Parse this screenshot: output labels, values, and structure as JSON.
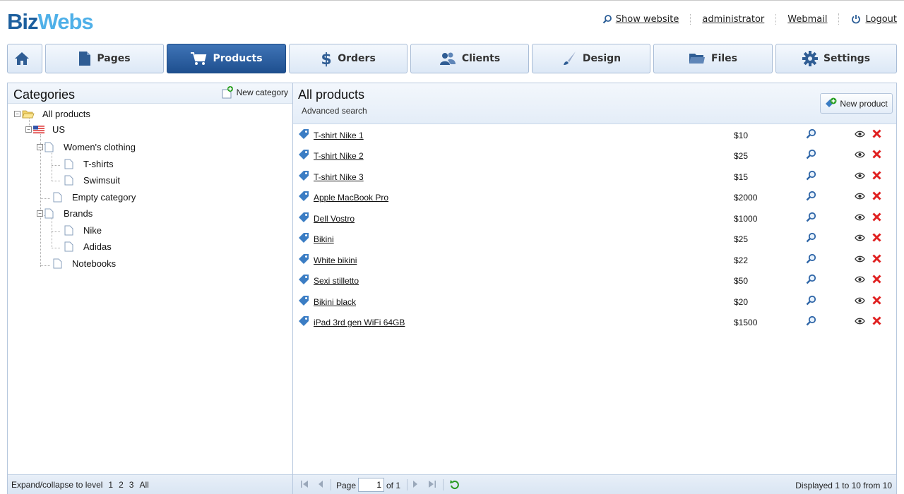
{
  "header": {
    "logo_part1": "Biz",
    "logo_part2": "Webs",
    "links": [
      "Show website",
      "administrator",
      "Webmail",
      "Logout"
    ]
  },
  "nav": {
    "tabs": [
      {
        "label": "",
        "icon": "home-icon"
      },
      {
        "label": "Pages",
        "icon": "page-icon"
      },
      {
        "label": "Products",
        "icon": "cart-icon",
        "active": true
      },
      {
        "label": "Orders",
        "icon": "dollar-icon"
      },
      {
        "label": "Clients",
        "icon": "users-icon"
      },
      {
        "label": "Design",
        "icon": "brush-icon"
      },
      {
        "label": "Files",
        "icon": "folder-icon"
      },
      {
        "label": "Settings",
        "icon": "gear-icon"
      }
    ]
  },
  "categories": {
    "title": "Categories",
    "new_category": "New category",
    "tree": [
      "All products",
      "US",
      "Women's clothing",
      "T-shirts",
      "Swimsuit",
      "Empty category",
      "Brands",
      "Nike",
      "Adidas",
      "Notebooks"
    ],
    "footer_label": "Expand/collapse to level",
    "levels": [
      "1",
      "2",
      "3",
      "All"
    ]
  },
  "products": {
    "title": "All products",
    "advanced_search": "Advanced search",
    "new_product": "New product",
    "items": [
      {
        "name": "T-shirt Nike 1",
        "price": "$10"
      },
      {
        "name": "T-shirt Nike 2",
        "price": "$25"
      },
      {
        "name": "T-shirt Nike 3",
        "price": "$15"
      },
      {
        "name": "Apple MacBook Pro",
        "price": "$2000"
      },
      {
        "name": "Dell Vostro",
        "price": "$1000"
      },
      {
        "name": "Bikini",
        "price": "$25"
      },
      {
        "name": "White bikini",
        "price": "$22"
      },
      {
        "name": "Sexi stilletto",
        "price": "$50"
      },
      {
        "name": "Bikini black",
        "price": "$20"
      },
      {
        "name": "iPad 3rd gen WiFi 64GB",
        "price": "$1500"
      }
    ]
  },
  "pager": {
    "page_label": "Page",
    "page_value": "1",
    "of_label": "of 1",
    "displayed": "Displayed 1 to 10 from 10"
  },
  "colors": {
    "accent": "#1e4f8f",
    "delete": "#e02020",
    "tag": "#3b7dc4"
  }
}
